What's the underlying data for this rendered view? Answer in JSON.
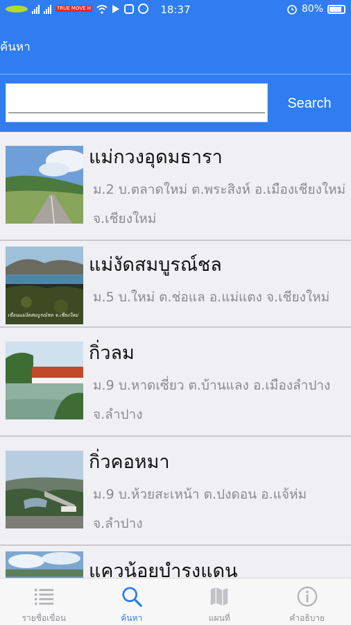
{
  "status_bar": {
    "time": "18:37",
    "battery": "80%",
    "carrier_label": "TRUE MOVE H",
    "icons": [
      "ais-logo",
      "signal-icon",
      "signal-icon",
      "wifi-icon",
      "play-icon",
      "instagram-icon",
      "circle-icon",
      "alarm-icon",
      "battery-icon"
    ]
  },
  "header": {
    "title": "ค้นหา"
  },
  "search": {
    "value": "",
    "button_label": "Search"
  },
  "dams": [
    {
      "name": "แม่กวงอุดมธารา",
      "address": "ม.2 บ.ตลาดใหม่ ต.พระสิงห์ อ.เมืองเชียงใหม่ จ.เชียงใหม่",
      "image": "road-hill-photo"
    },
    {
      "name": "แม่งัดสมบูรณ์ชล",
      "address": "ม.5 บ.ใหม่ ต.ช่อแล อ.แม่แตง จ.เชียงใหม่",
      "image": "reservoir-mountain-photo",
      "caption": "เขื่อนแม่งัดสมบูรณ์ชล จ.เชียงใหม่"
    },
    {
      "name": "กิ่วลม",
      "address": "ม.9 บ.หาดเซี่ยว ต.บ้านแลง อ.เมืองลำปาง จ.ลำปาง",
      "image": "spillway-photo"
    },
    {
      "name": "กิ่วคอหมา",
      "address": "ม.9 บ.ห้วยสะเหน้า ต.ปงดอน อ.แจ้ห่ม จ.ลำปาง",
      "image": "dam-valley-photo"
    },
    {
      "name": "แควน้อยบำรุงแดน",
      "address": "",
      "image": "sky-lake-photo"
    }
  ],
  "tabs": [
    {
      "label": "รายชื่อเขื่อน",
      "icon": "list-icon",
      "active": false
    },
    {
      "label": "ค้นหา",
      "icon": "search-icon",
      "active": true
    },
    {
      "label": "แผนที่",
      "icon": "map-icon",
      "active": false
    },
    {
      "label": "คำอธิบาย",
      "icon": "info-icon",
      "active": false
    }
  ],
  "colors": {
    "accent": "#2f7df0",
    "background": "#efeff4",
    "tab_inactive": "#8e8e93",
    "address_text": "#8a8a8f"
  }
}
